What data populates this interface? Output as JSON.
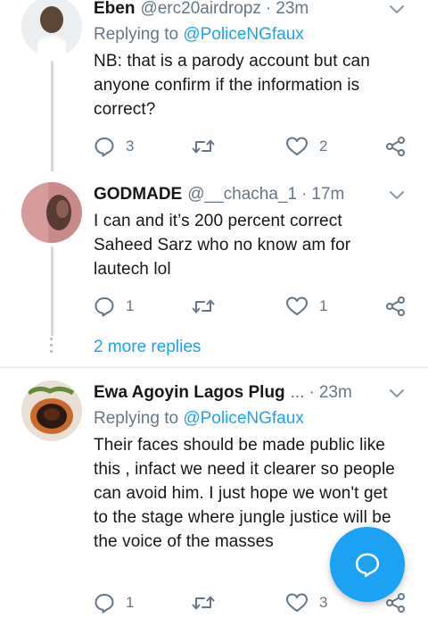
{
  "tweets": [
    {
      "name": "Eben",
      "handle": "@erc20airdropz",
      "separator": "·",
      "time": "23m",
      "replying_prefix": "Replying to",
      "replying_to": "@PoliceNGfaux",
      "body": "NB: that is a parody account but can anyone confirm if the information is correct?",
      "replies": "3",
      "retweets": "",
      "likes": "2"
    },
    {
      "name": "GODMADE",
      "handle": "@__chacha_1",
      "separator": "·",
      "time": "17m",
      "body": "I can and it’s 200 percent correct Saheed Sarz who no know am for lautech lol",
      "replies": "1",
      "retweets": "",
      "likes": "1"
    },
    {
      "name": "Ewa Agoyin Lagos Plug",
      "name_ellipsis": "...",
      "separator": "·",
      "time": "23m",
      "replying_prefix": "Replying to",
      "replying_to": "@PoliceNGfaux",
      "body": "Their faces should be made public like this , infact we need it clearer so people can avoid him. I just hope we won't get to the stage where jungle justice will be the voice of the masses",
      "replies": "1",
      "retweets": "",
      "likes": "3"
    }
  ],
  "more_replies": "2 more replies",
  "icons": {
    "reply": "reply-icon",
    "retweet": "retweet-icon",
    "like": "heart-icon",
    "share": "share-icon",
    "caret": "chevron-down-icon",
    "compose": "compose-reply-icon"
  },
  "colors": {
    "accent": "#1da1f2",
    "secondary_text": "#657786",
    "primary_text": "#14171a",
    "divider": "#e1e8ed"
  }
}
